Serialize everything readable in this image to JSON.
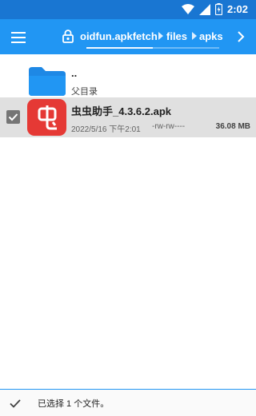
{
  "status_bar": {
    "time": "2:02",
    "icons": [
      "wifi-icon",
      "signal-icon",
      "battery-icon"
    ]
  },
  "toolbar": {
    "menu_icon": "hamburger-menu-icon",
    "path": {
      "segments": [
        "oidfun.apkfetch",
        "files",
        "apks"
      ],
      "lock_icon": "lock-icon",
      "progress": 0.5
    },
    "next_icon": "chevron-right-icon"
  },
  "file_list": {
    "parent": {
      "name": "..",
      "label": "父目录",
      "icon": "folder-icon"
    },
    "items": [
      {
        "name": "虫虫助手_4.3.6.2.apk",
        "date": "2022/5/16 下午2:01",
        "permissions": "-rw-rw----",
        "size": "36.08 MB",
        "selected": true,
        "icon": "app-icon"
      }
    ]
  },
  "bottom_bar": {
    "selection_text": "已选择 1 个文件。",
    "done_icon": "check-icon"
  },
  "colors": {
    "primary": "#2196f3",
    "primary_dark": "#1976d2",
    "selected_row": "#e0e0e0",
    "apk_icon_bg": "#e53935"
  }
}
